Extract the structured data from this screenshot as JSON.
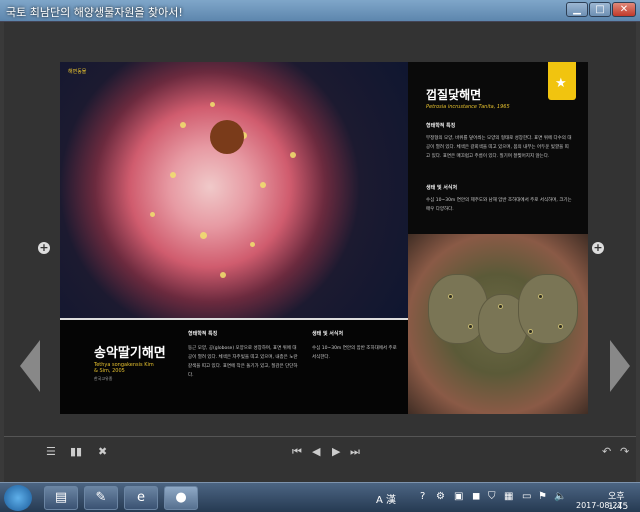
{
  "window": {
    "title": "국토 최남단의 해양생물자원을 찾아서!",
    "min_label": "▁",
    "max_label": "□",
    "close_label": "✕"
  },
  "left_page": {
    "category": "해면동물",
    "name": "송악딸기해면",
    "scientific": "Tethya songakensis Kim & Sim, 2005",
    "type_label": "한국고유종",
    "morph_heading": "형태학적 특징",
    "morph_text": "둥근 모양, 공(globose) 모양으로 성장하며, 표면 위에 대공이 열려 있다. 체색은 자주빛을 띠고 있으며, 내층은 노란 갈색을 띠고 있다. 표면에 작은 돌기가 있고, 질감은 단단하다.",
    "eco_heading": "생태 및 서식처",
    "eco_text": "수심 10~30m 연안의 암반 조하대에서 주로 서식한다."
  },
  "right_page": {
    "name": "껍질닻해면",
    "scientific": "Petrosia incrustance Tanita, 1965",
    "bookmark": "★",
    "morph_heading": "형태학적 특징",
    "morph_text": "부정형의 모양, 바위를 덮어씌는 모양의 형태로 성장한다. 표면 위에 다수의 대공이 열려 있다. 체색은 갈회색을 띠고 있으며, 몸의 내부는 어두운 빛깔을 띠고 있다. 표면은 매끄럽고 주름이 있다. 질기며 잘찢어지지 않는다.",
    "eco_heading": "생태 및 서식처",
    "eco_text": "수심 10~30m 연안의 제주도와 남해 암반 조하대에서 주로 서식하며, 크기는 매우 다양하다."
  },
  "side": {
    "plus": "+",
    "prev_icon": "prev-page-icon",
    "next_icon": "next-page-icon"
  },
  "toolbar": {
    "list": "☰",
    "double": "▮▮",
    "close": "✖",
    "first": "⏮",
    "prev": "◀",
    "next": "▶",
    "last": "⏭",
    "undo": "↶",
    "redo": "↷"
  },
  "taskbar": {
    "ime": "A 漢",
    "time": "오후 1:45",
    "date": "2017-08-27"
  }
}
